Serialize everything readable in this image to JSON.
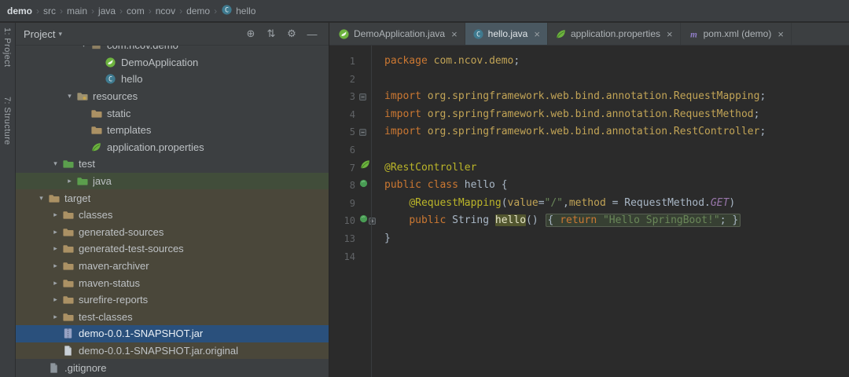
{
  "glyphs": {
    "expanded": "▾",
    "collapsed": "▸",
    "close": "×",
    "crumb_sep": "›",
    "title_arrow": "▾",
    "fold_open": "−",
    "fold_closed": "+"
  },
  "breadcrumb": {
    "items": [
      "demo",
      "src",
      "main",
      "java",
      "com",
      "ncov",
      "demo",
      "hello"
    ],
    "last_icon": "class"
  },
  "tool_strip": {
    "tabs": [
      {
        "label": "1: Project"
      },
      {
        "label": "7: Structure"
      }
    ]
  },
  "project_panel": {
    "title": "Project",
    "toolbar": [
      {
        "name": "locate",
        "glyph": "⊕"
      },
      {
        "name": "collapse-all",
        "glyph": "⇅"
      },
      {
        "name": "settings",
        "glyph": "⚙"
      },
      {
        "name": "hide",
        "glyph": "—"
      }
    ],
    "tree": [
      {
        "label": "com.ncov.demo",
        "icon": "package",
        "level": 4,
        "arrow": "down",
        "bg": "normal"
      },
      {
        "label": "DemoApplication",
        "icon": "springboot",
        "level": 5,
        "arrow": "none",
        "bg": "normal"
      },
      {
        "label": "hello",
        "icon": "class",
        "level": 5,
        "arrow": "none",
        "bg": "normal"
      },
      {
        "label": "resources",
        "icon": "resources",
        "level": 3,
        "arrow": "down",
        "bg": "normal"
      },
      {
        "label": "static",
        "icon": "folder",
        "level": 4,
        "arrow": "none",
        "bg": "normal"
      },
      {
        "label": "templates",
        "icon": "folder",
        "level": 4,
        "arrow": "none",
        "bg": "normal"
      },
      {
        "label": "application.properties",
        "icon": "spring",
        "level": 4,
        "arrow": "none",
        "bg": "normal"
      },
      {
        "label": "test",
        "icon": "folder-test",
        "level": 2,
        "arrow": "down",
        "bg": "normal"
      },
      {
        "label": "java",
        "icon": "folder-test",
        "level": 3,
        "arrow": "right",
        "bg": "test"
      },
      {
        "label": "target",
        "icon": "folder",
        "level": 1,
        "arrow": "down",
        "bg": "excluded"
      },
      {
        "label": "classes",
        "icon": "folder",
        "level": 2,
        "arrow": "right",
        "bg": "excluded"
      },
      {
        "label": "generated-sources",
        "icon": "folder",
        "level": 2,
        "arrow": "right",
        "bg": "excluded"
      },
      {
        "label": "generated-test-sources",
        "icon": "folder",
        "level": 2,
        "arrow": "right",
        "bg": "excluded"
      },
      {
        "label": "maven-archiver",
        "icon": "folder",
        "level": 2,
        "arrow": "right",
        "bg": "excluded"
      },
      {
        "label": "maven-status",
        "icon": "folder",
        "level": 2,
        "arrow": "right",
        "bg": "excluded"
      },
      {
        "label": "surefire-reports",
        "icon": "folder",
        "level": 2,
        "arrow": "right",
        "bg": "excluded"
      },
      {
        "label": "test-classes",
        "icon": "folder",
        "level": 2,
        "arrow": "right",
        "bg": "excluded"
      },
      {
        "label": "demo-0.0.1-SNAPSHOT.jar",
        "icon": "jar",
        "level": 2,
        "arrow": "none",
        "bg": "selected"
      },
      {
        "label": "demo-0.0.1-SNAPSHOT.jar.original",
        "icon": "file",
        "level": 2,
        "arrow": "none",
        "bg": "excluded"
      },
      {
        "label": ".gitignore",
        "icon": "gitignore",
        "level": 1,
        "arrow": "none",
        "bg": "normal"
      }
    ]
  },
  "editor": {
    "tabs": [
      {
        "label": "DemoApplication.java",
        "icon": "springboot",
        "active": false
      },
      {
        "label": "hello.java",
        "icon": "class",
        "active": true
      },
      {
        "label": "application.properties",
        "icon": "spring",
        "active": false
      },
      {
        "label": "pom.xml (demo)",
        "icon": "maven",
        "active": false
      }
    ],
    "code": {
      "lines": [
        {
          "num": "1",
          "gutter": [],
          "tokens": [
            [
              "kw",
              "package "
            ],
            [
              "gold",
              "com.ncov.demo"
            ],
            [
              "plain",
              ";"
            ]
          ]
        },
        {
          "num": "2",
          "gutter": [],
          "tokens": []
        },
        {
          "num": "3",
          "gutter": [
            "fold-open"
          ],
          "tokens": [
            [
              "kw",
              "import "
            ],
            [
              "gold",
              "org.springframework.web.bind.annotation.RequestMapping"
            ],
            [
              "plain",
              ";"
            ]
          ]
        },
        {
          "num": "4",
          "gutter": [],
          "tokens": [
            [
              "kw",
              "import "
            ],
            [
              "gold",
              "org.springframework.web.bind.annotation.RequestMethod"
            ],
            [
              "plain",
              ";"
            ]
          ]
        },
        {
          "num": "5",
          "gutter": [
            "fold-open"
          ],
          "tokens": [
            [
              "kw",
              "import "
            ],
            [
              "gold",
              "org.springframework.web.bind.annotation.RestController"
            ],
            [
              "plain",
              ";"
            ]
          ]
        },
        {
          "num": "6",
          "gutter": [],
          "tokens": []
        },
        {
          "num": "7",
          "gutter": [
            "spring-leaf"
          ],
          "tokens": [
            [
              "ann",
              "@RestController"
            ]
          ]
        },
        {
          "num": "8",
          "gutter": [
            "spring-bean"
          ],
          "tokens": [
            [
              "kw",
              "public class "
            ],
            [
              "plain",
              "hello {"
            ]
          ]
        },
        {
          "num": "9",
          "gutter": [],
          "tokens": [
            [
              "plain",
              "    "
            ],
            [
              "ann",
              "@RequestMapping"
            ],
            [
              "plain",
              "("
            ],
            [
              "gold",
              "value"
            ],
            [
              "plain",
              "="
            ],
            [
              "str",
              "\"/\""
            ],
            [
              "plain",
              ","
            ],
            [
              "gold",
              "method"
            ],
            [
              "plain",
              " = "
            ],
            [
              "plain",
              "RequestMethod"
            ],
            [
              "plain",
              "."
            ],
            [
              "field",
              "GET"
            ],
            [
              "plain",
              ")"
            ]
          ]
        },
        {
          "num": "10",
          "gutter": [
            "spring-bean",
            "fold-closed"
          ],
          "tokens": [
            [
              "plain",
              "    "
            ],
            [
              "kw",
              "public "
            ],
            [
              "plain",
              "String "
            ],
            [
              "hl",
              "hello"
            ],
            [
              "plain",
              "() "
            ],
            [
              "fold",
              [
                [
                  "plain",
                  "{ "
                ],
                [
                  "kw",
                  "return "
                ],
                [
                  "str",
                  "\"Hello SpringBoot!\""
                ],
                [
                  "plain",
                  "; }"
                ]
              ]
            ]
          ]
        },
        {
          "num": "13",
          "gutter": [],
          "tokens": [
            [
              "plain",
              "}"
            ]
          ]
        },
        {
          "num": "14",
          "gutter": [],
          "tokens": []
        }
      ]
    }
  },
  "colors": {
    "panel_bg": "#3c3f41",
    "editor_bg": "#2b2b2b",
    "selection_bg": "#2a507c",
    "excluded_row_bg": "#4a473a",
    "test_row_bg": "#414d3a",
    "keyword": "#cc7832",
    "string": "#6a8759",
    "annotation": "#bbb529",
    "qualified_name": "#c2a456",
    "constant": "#9876aa",
    "line_number": "#606366",
    "spring_green": "#6db33f"
  }
}
